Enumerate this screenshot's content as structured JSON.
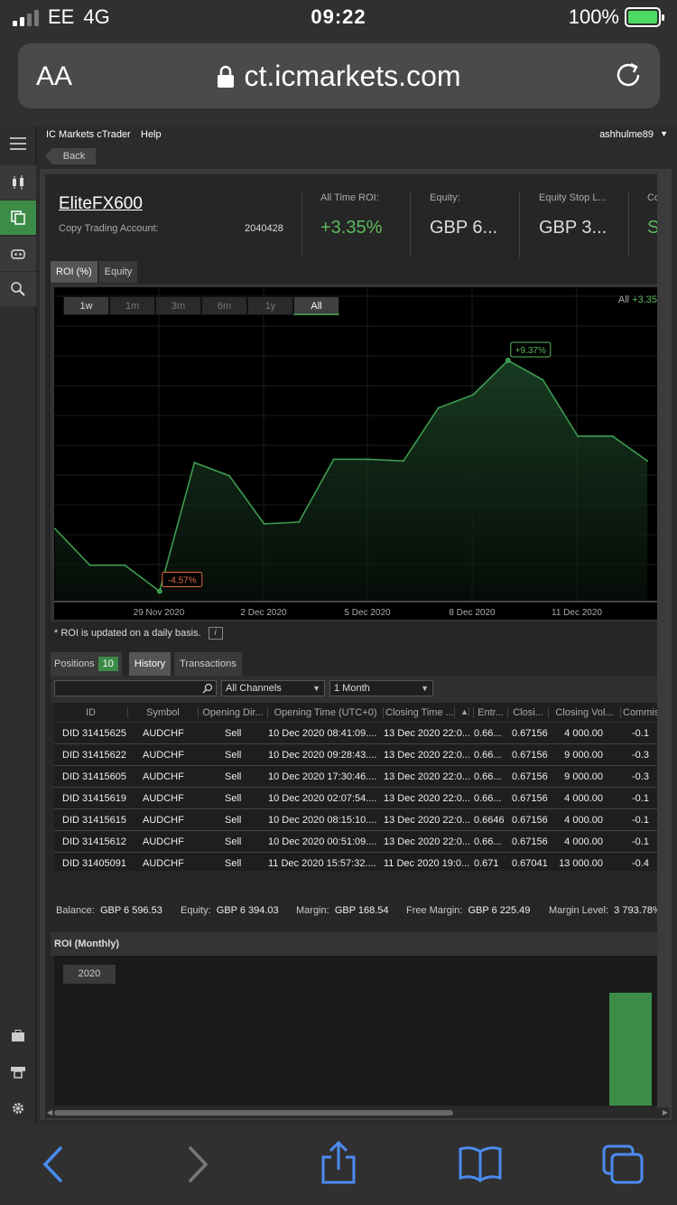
{
  "status": {
    "carrier": "EE",
    "network": "4G",
    "time": "09:22",
    "battery": "100%"
  },
  "browser": {
    "aa": "AA",
    "url": "ct.icmarkets.com"
  },
  "menu": {
    "app": "IC Markets cTrader",
    "help": "Help",
    "user": "ashhulme89"
  },
  "back_label": "Back",
  "account": {
    "name": "EliteFX600",
    "account_label": "Copy Trading Account:",
    "account_number": "2040428",
    "stats": [
      {
        "label": "All Time ROI:",
        "value": "+3.35%",
        "color": "#5cb85c"
      },
      {
        "label": "Equity:",
        "value": "GBP 6...",
        "color": "#dddddd"
      },
      {
        "label": "Equity Stop L...",
        "value": "GBP 3...",
        "color": "#dddddd"
      },
      {
        "label": "Co",
        "value": "S",
        "color": "#5cb85c"
      }
    ]
  },
  "chart_tabs": [
    "ROI (%)",
    "Equity"
  ],
  "ranges": [
    "1w",
    "1m",
    "3m",
    "6m",
    "1y",
    "All"
  ],
  "chart_data": {
    "type": "area",
    "legend_label": "All",
    "legend_value": "+3.35",
    "x_ticks": [
      "29 Nov 2020",
      "2 Dec 2020",
      "5 Dec 2020",
      "8 Dec 2020",
      "11 Dec 2020"
    ],
    "points": [
      [
        0,
        -0.8
      ],
      [
        1,
        -3.0
      ],
      [
        2,
        -3.0
      ],
      [
        3,
        -4.57
      ],
      [
        4,
        3.2
      ],
      [
        5,
        2.4
      ],
      [
        6,
        -0.5
      ],
      [
        7,
        -0.4
      ],
      [
        8,
        3.4
      ],
      [
        9,
        3.4
      ],
      [
        10,
        3.3
      ],
      [
        11,
        6.5
      ],
      [
        12,
        7.3
      ],
      [
        13,
        9.37
      ],
      [
        14,
        8.2
      ],
      [
        15,
        4.8
      ],
      [
        16,
        4.8
      ],
      [
        17,
        3.3
      ]
    ],
    "min_label": "-4.57%",
    "max_label": "+9.37%",
    "ylim": [
      -5.2,
      11.5
    ],
    "line_color": "#3c9c50"
  },
  "roi_note": "* ROI is updated on a daily basis.",
  "positions_tabs": {
    "positions": "Positions",
    "positions_count": "10",
    "history": "History",
    "transactions": "Transactions"
  },
  "filters": {
    "channel": "All Channels",
    "period": "1 Month"
  },
  "table": {
    "headers": [
      "ID",
      "Symbol",
      "Opening Dir...",
      "Opening Time (UTC+0)",
      "Closing Time ...",
      "Entr...",
      "Closi...",
      "Closing Vol...",
      "Commis"
    ],
    "rows": [
      [
        "DID 31415625",
        "AUDCHF",
        "Sell",
        "10 Dec 2020 08:41:09....",
        "13 Dec 2020 22:0...",
        "0.66...",
        "0.67156",
        "4 000.00",
        "-0.1"
      ],
      [
        "DID 31415622",
        "AUDCHF",
        "Sell",
        "10 Dec 2020 09:28:43....",
        "13 Dec 2020 22:0...",
        "0.66...",
        "0.67156",
        "9 000.00",
        "-0.3"
      ],
      [
        "DID 31415605",
        "AUDCHF",
        "Sell",
        "10 Dec 2020 17:30:46....",
        "13 Dec 2020 22:0...",
        "0.66...",
        "0.67156",
        "9 000.00",
        "-0.3"
      ],
      [
        "DID 31415619",
        "AUDCHF",
        "Sell",
        "10 Dec 2020 02:07:54....",
        "13 Dec 2020 22:0...",
        "0.66...",
        "0.67156",
        "4 000.00",
        "-0.1"
      ],
      [
        "DID 31415615",
        "AUDCHF",
        "Sell",
        "10 Dec 2020 08:15:10....",
        "13 Dec 2020 22:0...",
        "0.6646",
        "0.67156",
        "4 000.00",
        "-0.1"
      ],
      [
        "DID 31415612",
        "AUDCHF",
        "Sell",
        "10 Dec 2020 00:51:09....",
        "13 Dec 2020 22:0...",
        "0.66...",
        "0.67156",
        "4 000.00",
        "-0.1"
      ],
      [
        "DID 31405091",
        "AUDCHF",
        "Sell",
        "11 Dec 2020 15:57:32....",
        "11 Dec 2020 19:0...",
        "0.671",
        "0.67041",
        "13 000.00",
        "-0.4"
      ]
    ]
  },
  "summary": {
    "balance_label": "Balance:",
    "balance": "GBP 6 596.53",
    "equity_label": "Equity:",
    "equity": "GBP 6 394.03",
    "margin_label": "Margin:",
    "margin": "GBP 168.54",
    "free_margin_label": "Free Margin:",
    "free_margin": "GBP 6 225.49",
    "margin_level_label": "Margin Level:",
    "margin_level": "3 793.78%"
  },
  "monthly": {
    "title": "ROI (Monthly)",
    "year": "2020"
  }
}
